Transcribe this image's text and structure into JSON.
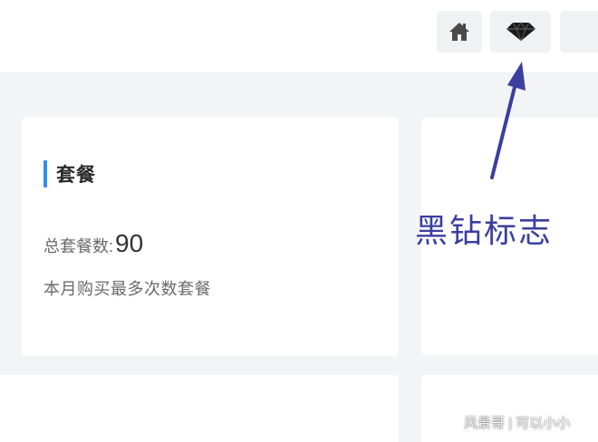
{
  "header": {
    "home_icon": "home-icon",
    "diamond_icon": "black-diamond-icon"
  },
  "package_card": {
    "title": "套餐",
    "total_label": "总套餐数:",
    "total_value": "90",
    "most_bought_label": "本月购买最多次数套餐"
  },
  "annotation": {
    "text": "黑钻标志",
    "color": "#3a3fa0"
  },
  "watermark": {
    "text": "风景哥 | 可以小小"
  },
  "colors": {
    "accent": "#2f8ff0",
    "arrow": "#3a3fa0",
    "background": "#f3f4f6"
  }
}
